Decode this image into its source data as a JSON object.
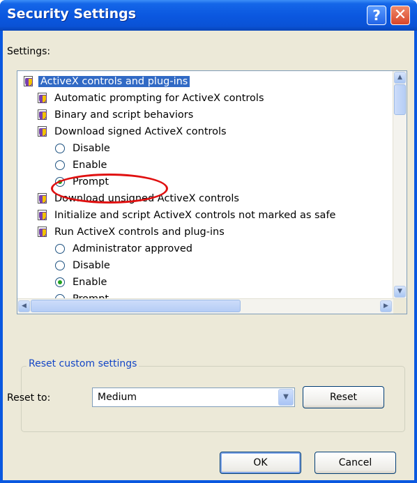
{
  "window": {
    "title": "Security Settings",
    "help_glyph": "?",
    "close_glyph": "✕"
  },
  "settings": {
    "label": "Settings:",
    "items": [
      {
        "kind": "category",
        "label": "ActiveX controls and plug-ins",
        "selected": true
      },
      {
        "kind": "setting",
        "label": "Automatic prompting for ActiveX controls"
      },
      {
        "kind": "setting",
        "label": "Binary and script behaviors"
      },
      {
        "kind": "setting",
        "label": "Download signed ActiveX controls"
      },
      {
        "kind": "option",
        "label": "Disable",
        "checked": false
      },
      {
        "kind": "option",
        "label": "Enable",
        "checked": false
      },
      {
        "kind": "option",
        "label": "Prompt",
        "checked": true,
        "circled": true
      },
      {
        "kind": "setting",
        "label": "Download unsigned ActiveX controls"
      },
      {
        "kind": "setting",
        "label": "Initialize and script ActiveX controls not marked as safe"
      },
      {
        "kind": "setting",
        "label": "Run ActiveX controls and plug-ins"
      },
      {
        "kind": "option",
        "label": "Administrator approved",
        "checked": false
      },
      {
        "kind": "option",
        "label": "Disable",
        "checked": false
      },
      {
        "kind": "option",
        "label": "Enable",
        "checked": true,
        "circled": true
      },
      {
        "kind": "option",
        "label": "Prompt",
        "checked": false
      }
    ],
    "scroll_arrows": {
      "up": "▲",
      "down": "▼",
      "left": "◀",
      "right": "▶"
    }
  },
  "reset": {
    "group_title": "Reset custom settings",
    "label": "Reset to:",
    "selected_value": "Medium",
    "dropdown_glyph": "▼",
    "button_label": "Reset"
  },
  "footer": {
    "ok_label": "OK",
    "cancel_label": "Cancel"
  },
  "colors": {
    "title_bar": "#0a58e0",
    "selection": "#316ac5",
    "annotation_circle": "#e01010",
    "group_title": "#1446c6"
  }
}
